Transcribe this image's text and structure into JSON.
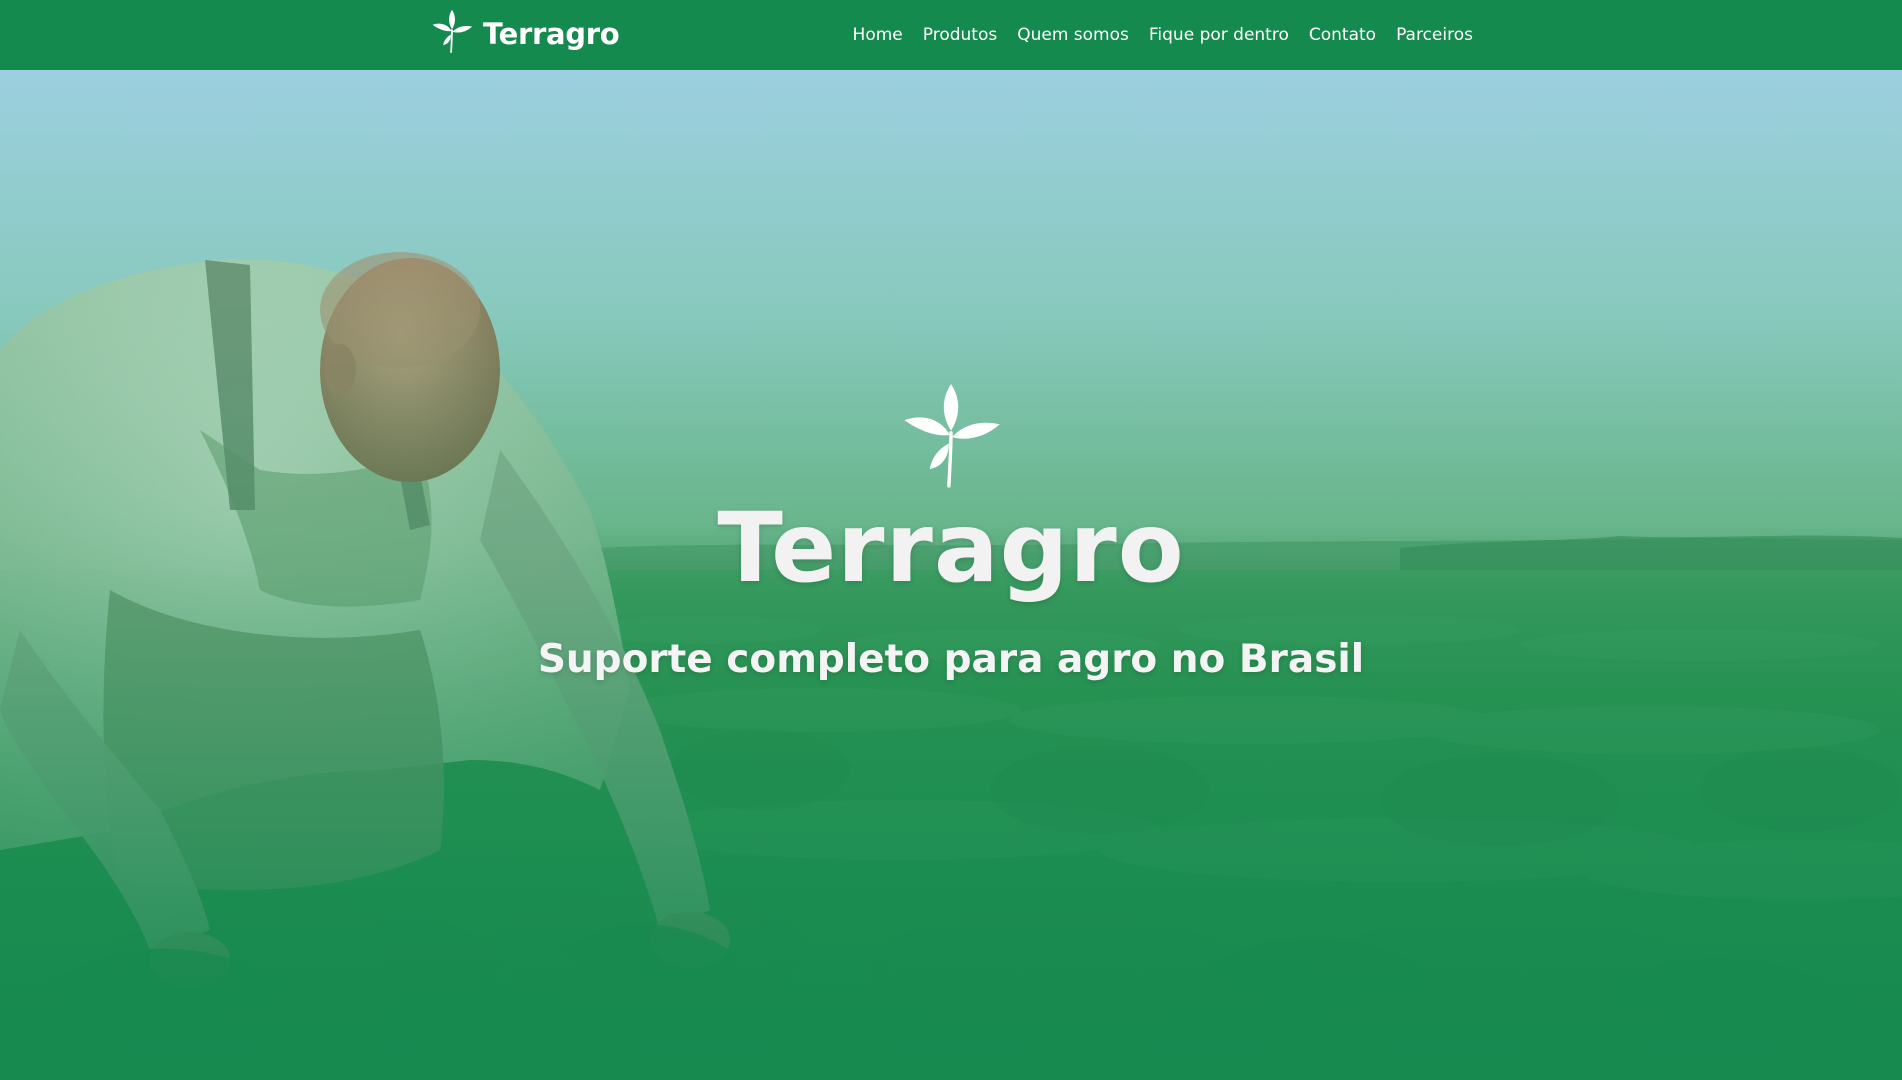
{
  "navbar": {
    "brand_name": "Terragro",
    "brand_icon": "sprout-icon",
    "links": [
      {
        "label": "Home"
      },
      {
        "label": "Produtos"
      },
      {
        "label": "Quem somos"
      },
      {
        "label": "Fique por dentro"
      },
      {
        "label": "Contato"
      },
      {
        "label": "Parceiros"
      }
    ]
  },
  "hero": {
    "logo_icon": "sprout-icon",
    "title": "Terragro",
    "subtitle": "Suporte completo para agro no Brasil",
    "background": "farmer-in-soybean-field-photo"
  },
  "colors": {
    "brand_green": "#148a4f",
    "overlay_green": "#15894f",
    "sky_blue": "#9fd3e0",
    "text_white": "#ffffff"
  }
}
